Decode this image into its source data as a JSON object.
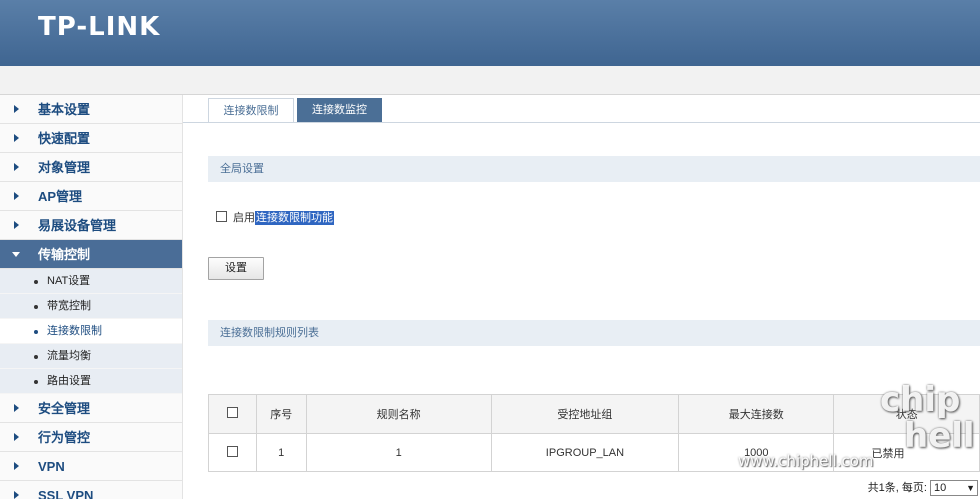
{
  "header": {
    "logo": "TP-LINK"
  },
  "sidebar": {
    "items_top": [
      {
        "label": "基本设置"
      },
      {
        "label": "快速配置"
      },
      {
        "label": "对象管理"
      },
      {
        "label": "AP管理"
      },
      {
        "label": "易展设备管理"
      }
    ],
    "active": {
      "label": "传输控制"
    },
    "sub_items": [
      {
        "label": "NAT设置"
      },
      {
        "label": "带宽控制"
      },
      {
        "label": "连接数限制"
      },
      {
        "label": "流量均衡"
      },
      {
        "label": "路由设置"
      }
    ],
    "items_bottom": [
      {
        "label": "安全管理"
      },
      {
        "label": "行为管控"
      },
      {
        "label": "VPN"
      },
      {
        "label": "SSL VPN"
      }
    ]
  },
  "tabs": [
    {
      "label": "连接数限制"
    },
    {
      "label": "连接数监控"
    }
  ],
  "global": {
    "title": "全局设置",
    "enable_prefix": "启用",
    "enable_label": "连接数限制功能",
    "button": "设置"
  },
  "rules": {
    "title": "连接数限制规则列表",
    "columns": [
      "序号",
      "规则名称",
      "受控地址组",
      "最大连接数",
      "状态"
    ],
    "rows": [
      {
        "index": "1",
        "name": "1",
        "group": "IPGROUP_LAN",
        "max": "1000",
        "status": "已禁用"
      }
    ]
  },
  "pager": {
    "total": "共1条,",
    "per_page_label": "每页:",
    "per_page": "10"
  },
  "watermark": {
    "text": "www.chiphell.com",
    "logo_1": "chip",
    "logo_2": "hell"
  }
}
